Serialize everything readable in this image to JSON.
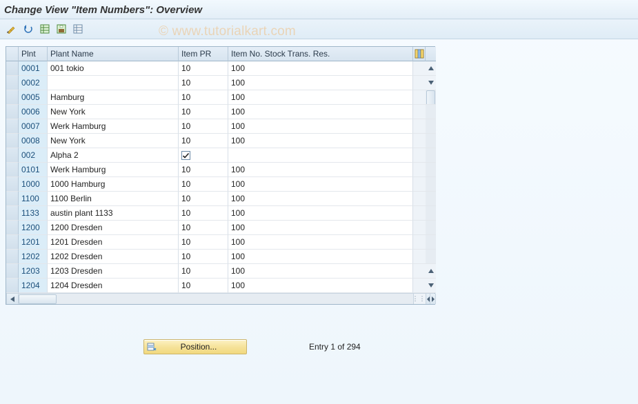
{
  "title": "Change View \"Item Numbers\": Overview",
  "watermark": "© www.tutorialkart.com",
  "toolbar": {
    "btn1_title": "Change",
    "btn2_title": "Undo",
    "btn3_title": "Select All",
    "btn4_title": "Save",
    "btn5_title": "Deselect All"
  },
  "columns": {
    "sel": "",
    "plnt": "Plnt",
    "plant_name": "Plant Name",
    "item_pr": "Item PR",
    "item_no_stock": "Item No. Stock Trans. Res."
  },
  "rows": [
    {
      "plnt": "0001",
      "name": "001 tokio",
      "pr": "10",
      "stock": "100",
      "check": false
    },
    {
      "plnt": "0002",
      "name": "",
      "pr": "10",
      "stock": "100",
      "check": false
    },
    {
      "plnt": "0005",
      "name": "Hamburg",
      "pr": "10",
      "stock": "100",
      "check": false
    },
    {
      "plnt": "0006",
      "name": "New York",
      "pr": "10",
      "stock": "100",
      "check": false
    },
    {
      "plnt": "0007",
      "name": "Werk Hamburg",
      "pr": "10",
      "stock": "100",
      "check": false
    },
    {
      "plnt": "0008",
      "name": "New York",
      "pr": "10",
      "stock": "100",
      "check": false
    },
    {
      "plnt": "002",
      "name": "Alpha 2",
      "pr": "",
      "stock": "",
      "check": true
    },
    {
      "plnt": "0101",
      "name": "Werk Hamburg",
      "pr": "10",
      "stock": "100",
      "check": false
    },
    {
      "plnt": "1000",
      "name": "1000 Hamburg",
      "pr": "10",
      "stock": "100",
      "check": false
    },
    {
      "plnt": "1100",
      "name": "1100 Berlin",
      "pr": "10",
      "stock": "100",
      "check": false
    },
    {
      "plnt": "1133",
      "name": "austin plant 1133",
      "pr": "10",
      "stock": "100",
      "check": false
    },
    {
      "plnt": "1200",
      "name": "1200 Dresden",
      "pr": "10",
      "stock": "100",
      "check": false
    },
    {
      "plnt": "1201",
      "name": "1201 Dresden",
      "pr": "10",
      "stock": "100",
      "check": false
    },
    {
      "plnt": "1202",
      "name": "1202 Dresden",
      "pr": "10",
      "stock": "100",
      "check": false
    },
    {
      "plnt": "1203",
      "name": "1203 Dresden",
      "pr": "10",
      "stock": "100",
      "check": false
    },
    {
      "plnt": "1204",
      "name": "1204 Dresden",
      "pr": "10",
      "stock": "100",
      "check": false
    }
  ],
  "footer": {
    "position_label": "Position...",
    "entry_text": "Entry 1 of 294"
  }
}
